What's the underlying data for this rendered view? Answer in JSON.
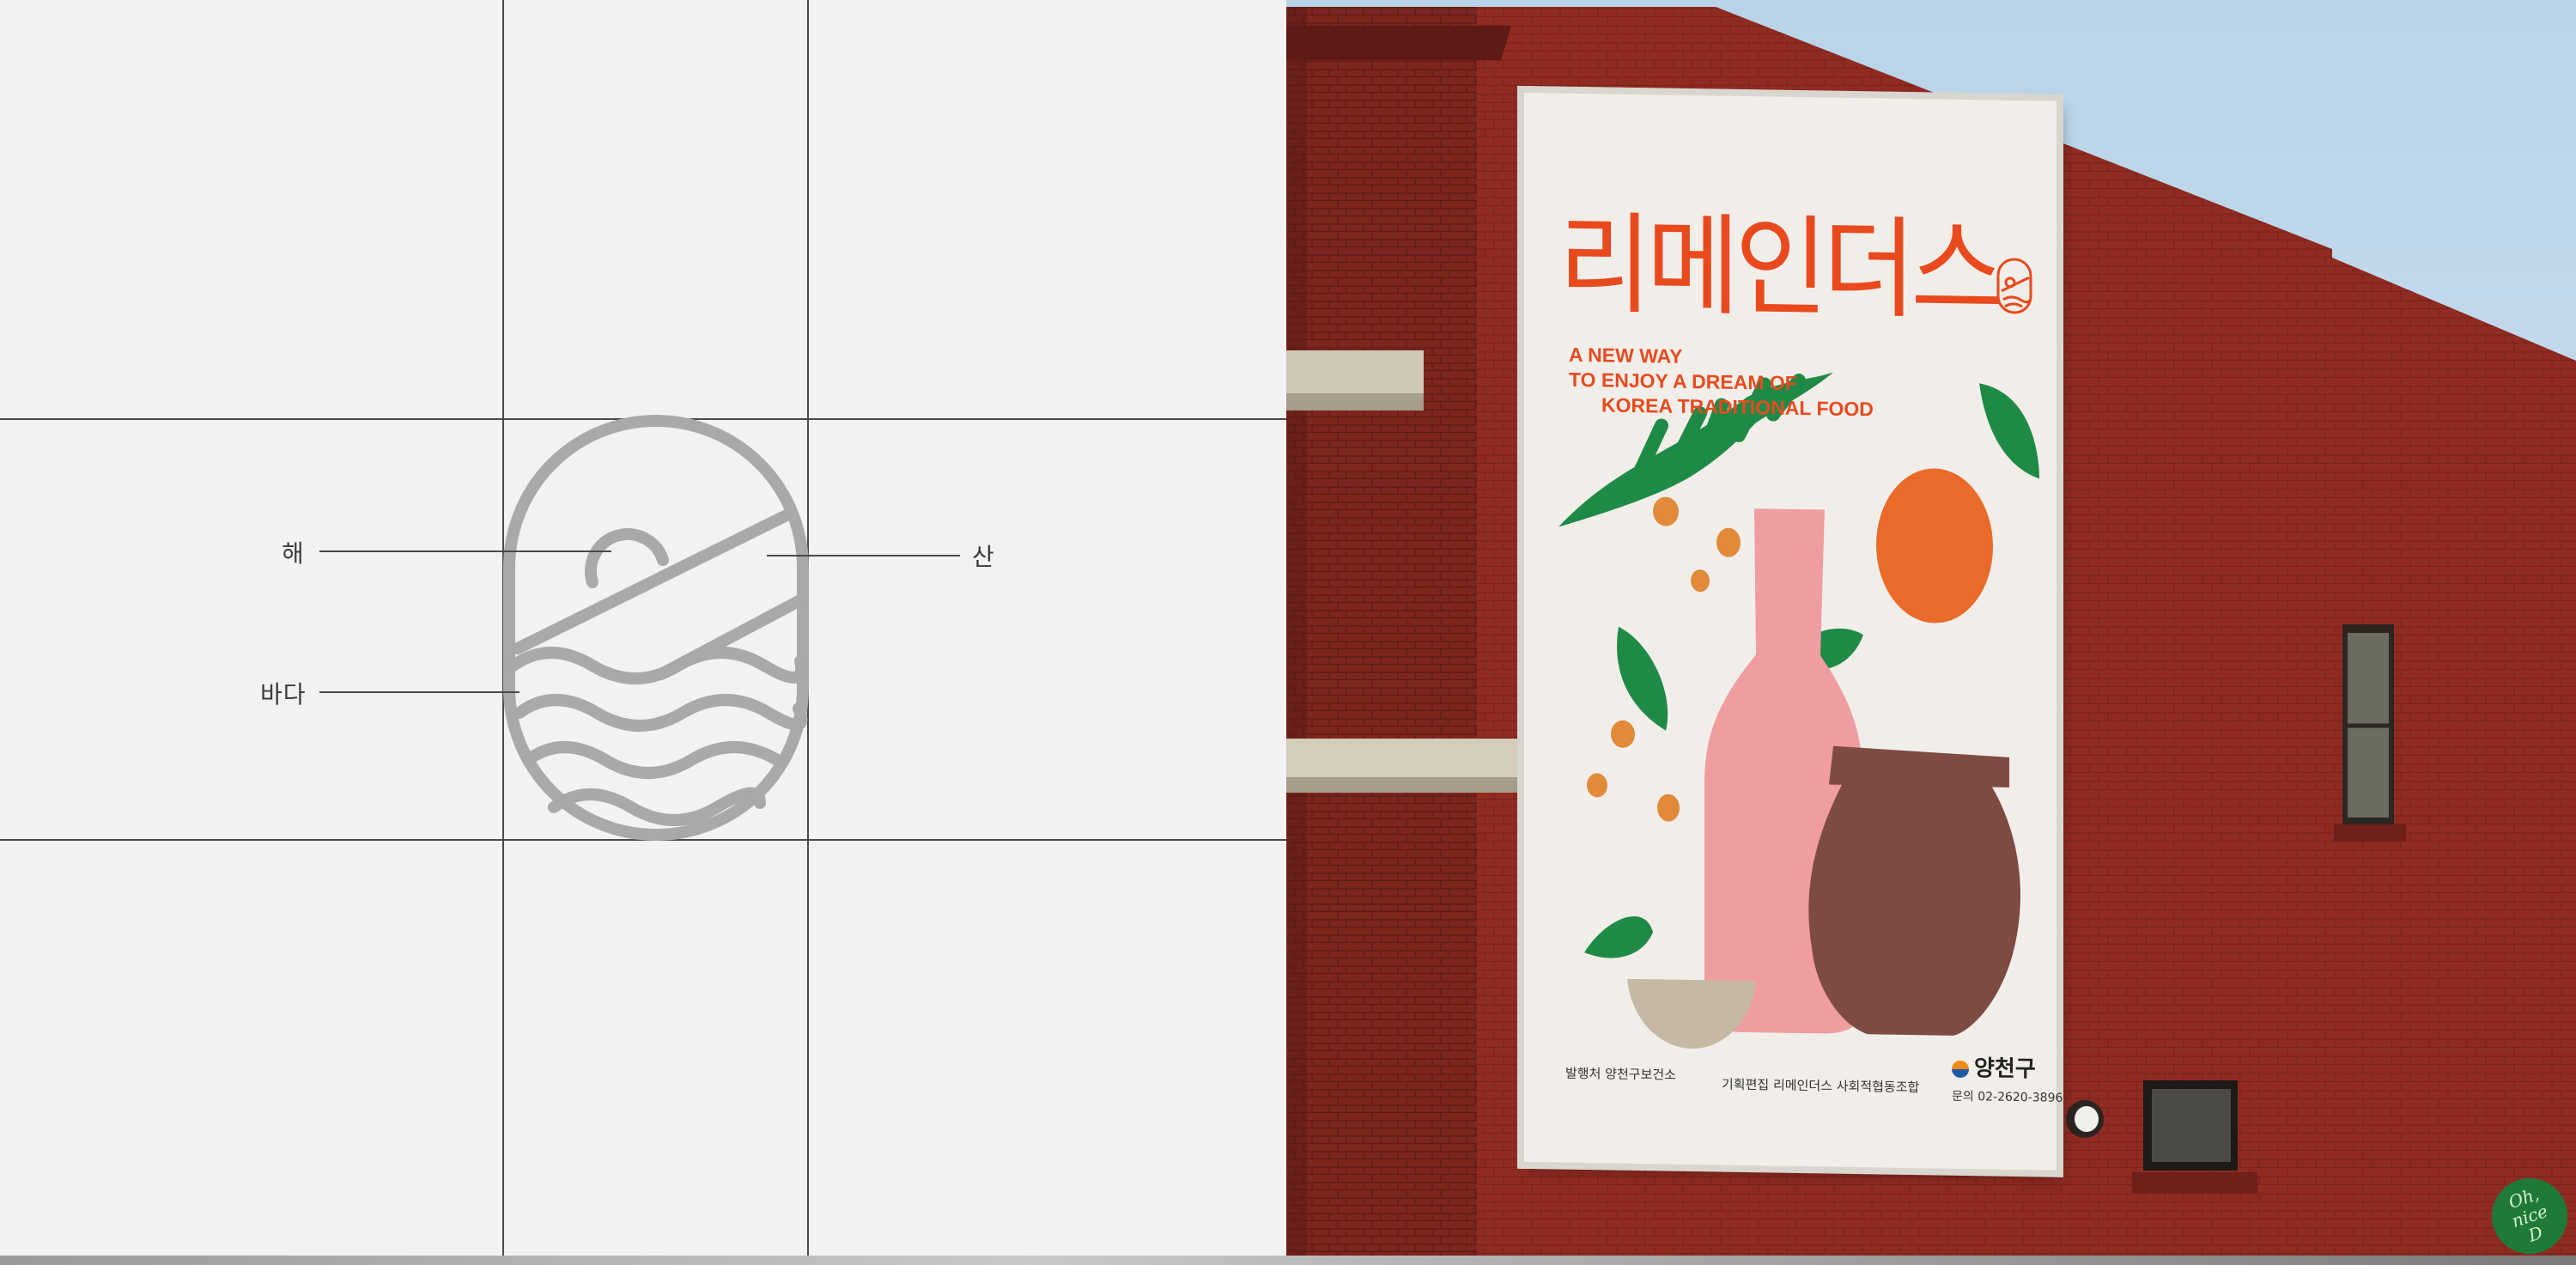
{
  "diagram": {
    "labels": {
      "sun": "해",
      "mountain": "산",
      "sea": "바다"
    },
    "line_color": "#4a4a4a",
    "logo_color": "#a9a9a9"
  },
  "poster": {
    "title": "리메인더스",
    "tagline": [
      "A NEW WAY",
      "TO ENJOY A DREAM OF",
      "KOREA TRADITIONAL FOOD"
    ],
    "publisher": "발행처 양천구보건소",
    "editor": "기획편집 리메인더스 사회적협동조합",
    "brand": "양천구",
    "contact": "문의 02-2620-3896",
    "accent_color": "#e84a1e"
  },
  "watermark": {
    "text": [
      "Oh,",
      "nice",
      "D"
    ]
  }
}
